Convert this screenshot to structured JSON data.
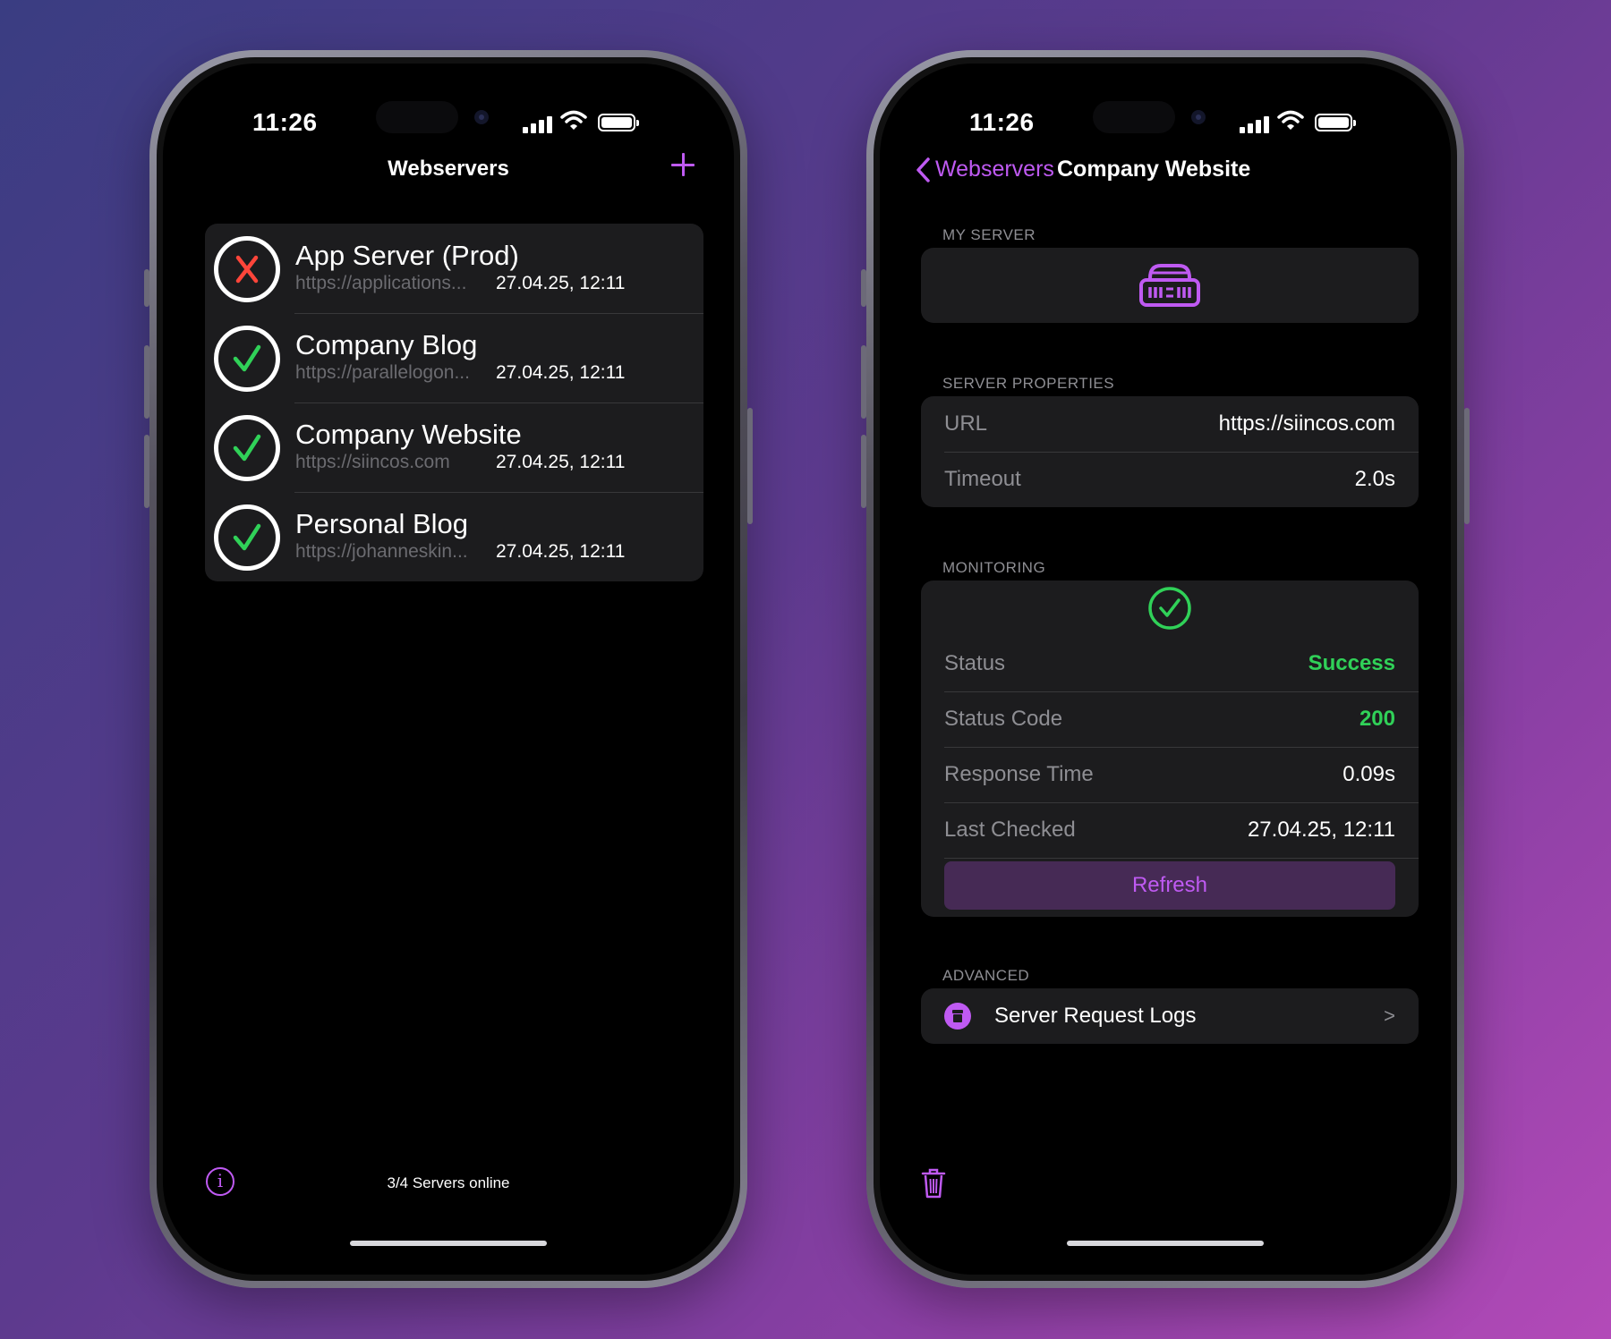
{
  "colors": {
    "accent": "#bf5af2",
    "success": "#30d158",
    "error": "#ff453a",
    "cell_bg": "#1c1c1e",
    "secondary_text": "#8e8e93"
  },
  "left_phone": {
    "status_bar": {
      "time": "11:26"
    },
    "nav": {
      "title": "Webservers",
      "add_icon": "plus-icon"
    },
    "servers": [
      {
        "name": "App Server (Prod)",
        "url": "https://applications...",
        "last_checked": "27.04.25, 12:11",
        "status": "error",
        "status_icon": "xmark-circle-icon"
      },
      {
        "name": "Company Blog",
        "url": "https://parallelogon...",
        "last_checked": "27.04.25, 12:11",
        "status": "online",
        "status_icon": "checkmark-circle-icon"
      },
      {
        "name": "Company Website",
        "url": "https://siincos.com",
        "last_checked": "27.04.25, 12:11",
        "status": "online",
        "status_icon": "checkmark-circle-icon"
      },
      {
        "name": "Personal Blog",
        "url": "https://johanneskin...",
        "last_checked": "27.04.25, 12:11",
        "status": "online",
        "status_icon": "checkmark-circle-icon"
      }
    ],
    "footer": {
      "summary": "3/4 Servers online",
      "info_icon": "info-icon",
      "info_glyph": "i"
    }
  },
  "right_phone": {
    "status_bar": {
      "time": "11:26"
    },
    "nav": {
      "back_label": "Webservers",
      "title": "Company Website"
    },
    "my_server": {
      "header": "MY SERVER",
      "icon": "server-rack-icon"
    },
    "server_properties": {
      "header": "SERVER PROPERTIES",
      "rows": [
        {
          "label": "URL",
          "value": "https://siincos.com"
        },
        {
          "label": "Timeout",
          "value": "2.0s"
        }
      ]
    },
    "monitoring": {
      "header": "MONITORING",
      "status_icon": "checkmark-circle-icon",
      "rows": [
        {
          "label": "Status",
          "value": "Success"
        },
        {
          "label": "Status Code",
          "value": "200"
        },
        {
          "label": "Response Time",
          "value": "0.09s"
        },
        {
          "label": "Last Checked",
          "value": "27.04.25, 12:11"
        }
      ],
      "refresh_label": "Refresh"
    },
    "advanced": {
      "header": "ADVANCED",
      "logs_label": "Server Request Logs",
      "logs_icon": "archive-box-icon",
      "chevron": ">"
    },
    "toolbar": {
      "delete_icon": "trash-icon"
    }
  }
}
